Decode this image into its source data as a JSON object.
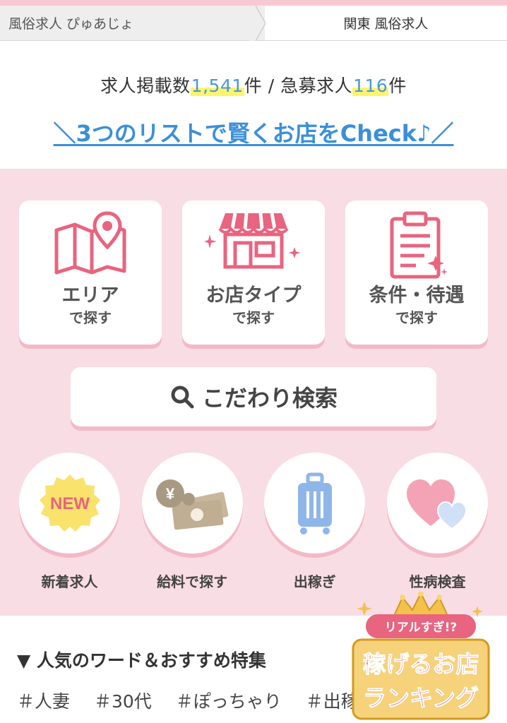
{
  "breadcrumb": {
    "site": "風俗求人 ぴゅあじょ",
    "current": "関東 風俗求人"
  },
  "summary": {
    "prefix": "求人掲載数",
    "total": "1,541",
    "unit1": "件 / 急募求人",
    "urgent": "116",
    "unit2": "件",
    "check_link": "＼3つのリストで賢くお店をCheck♪／"
  },
  "cards": [
    {
      "label": "エリア",
      "sub": "で探す",
      "icon": "map-pin-icon"
    },
    {
      "label": "お店タイプ",
      "sub": "で探す",
      "icon": "shop-icon"
    },
    {
      "label": "条件・待遇",
      "sub": "で探す",
      "icon": "clipboard-icon"
    }
  ],
  "kodawari": {
    "label": "こだわり検索",
    "icon": "search-icon"
  },
  "circles": [
    {
      "label": "新着求人",
      "icon": "new-badge-icon",
      "badge_text": "NEW"
    },
    {
      "label": "給料で探す",
      "icon": "money-icon",
      "yen": "¥"
    },
    {
      "label": "出稼ぎ",
      "icon": "suitcase-icon"
    },
    {
      "label": "性病検査",
      "icon": "hearts-icon"
    }
  ],
  "popular": {
    "title": "▼ 人気のワード＆おすすめ特集",
    "tags": [
      "＃人妻",
      "＃30代",
      "＃ぽっちゃり",
      "＃出稼"
    ]
  },
  "badge": {
    "line1": "リアルすぎ!?",
    "line2": "稼げるお店",
    "line3": "ランキング"
  },
  "colors": {
    "pink_bg": "#f9dde4",
    "accent_pink": "#e8647f",
    "link_blue": "#3b8fd9"
  }
}
